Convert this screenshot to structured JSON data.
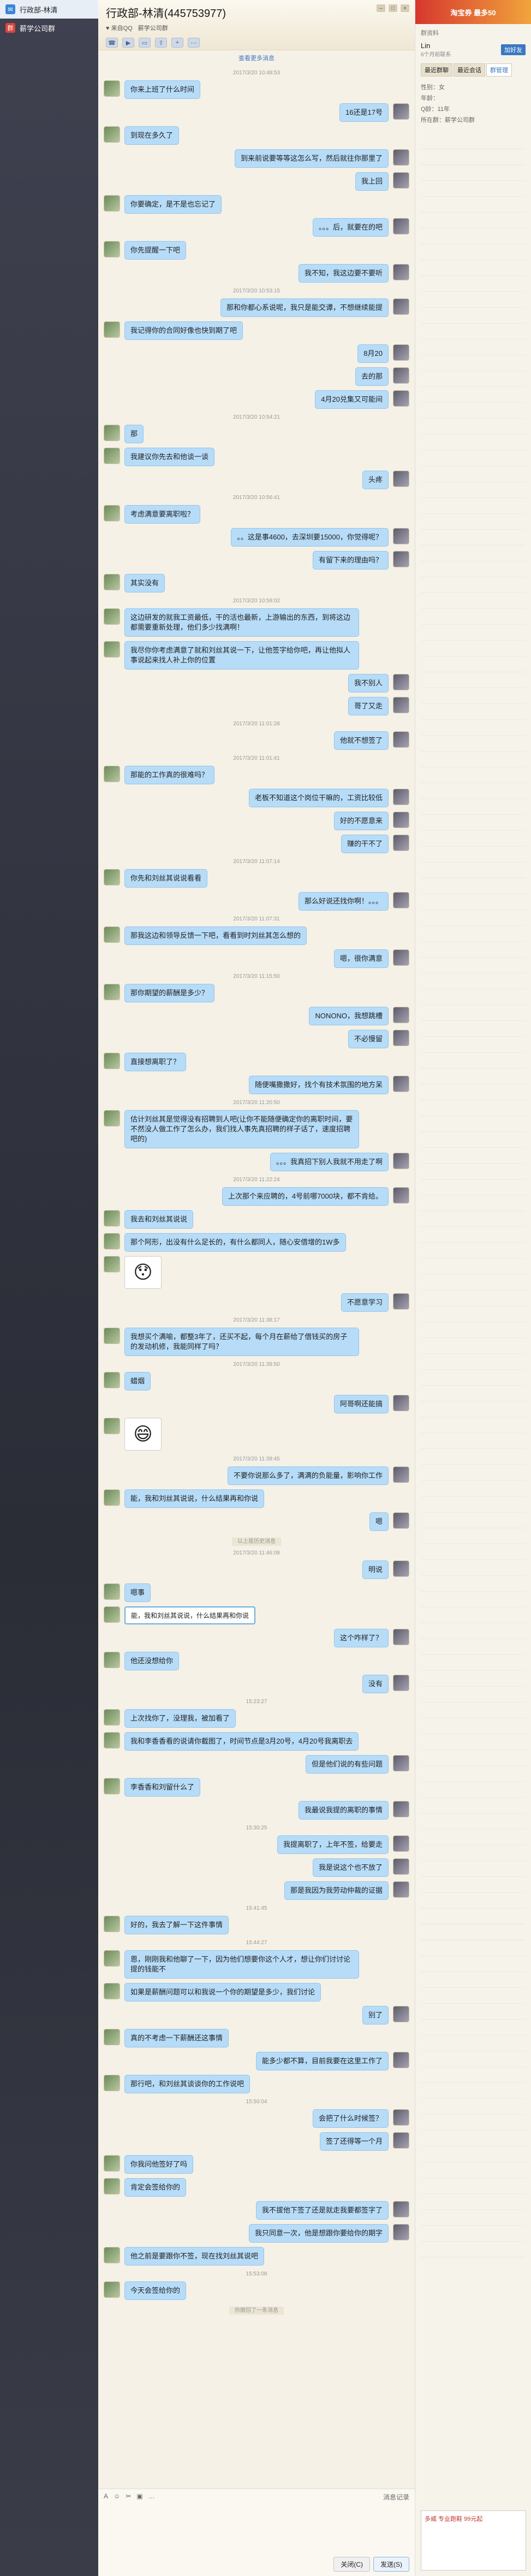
{
  "sessions": [
    {
      "label": "行政部-林清",
      "active": true
    },
    {
      "label": "薪学公司群",
      "active": false
    }
  ],
  "header": {
    "title": "行政部-林清(445753977)",
    "subtitle_left": "♥ 来自QQ",
    "subtitle_right": "薪学公司群"
  },
  "history_link": "查看更多消息",
  "messages": [
    {
      "type": "ts",
      "text": "2017/3/20 10:48:53"
    },
    {
      "type": "left",
      "text": "你来上班了什么时间"
    },
    {
      "type": "right",
      "text": "16还是17号"
    },
    {
      "type": "left",
      "text": "到现在多久了"
    },
    {
      "type": "right",
      "text": "到来前说要等等这怎么写，然后就往你那里了"
    },
    {
      "type": "right",
      "text": "我上回"
    },
    {
      "type": "left",
      "text": "你要确定，是不是也忘记了"
    },
    {
      "type": "right",
      "text": "。。。后，就要在的吧"
    },
    {
      "type": "left",
      "text": "你先提醒一下吧"
    },
    {
      "type": "right",
      "text": "我不知，我这边要不要听"
    },
    {
      "type": "ts",
      "text": "2017/3/20 10:53:15"
    },
    {
      "type": "right",
      "text": "那和你都心系说呢，我只是能交谭，不想继续能提"
    },
    {
      "type": "left",
      "text": "我记得你的合同好像也快到期了吧"
    },
    {
      "type": "right",
      "text": "8月20"
    },
    {
      "type": "right",
      "text": "去的那"
    },
    {
      "type": "right",
      "text": "4月20兑集又可能间"
    },
    {
      "type": "ts",
      "text": "2017/3/20 10:54:21"
    },
    {
      "type": "left",
      "text": "那"
    },
    {
      "type": "left",
      "text": "我建议你先去和他谈一谈"
    },
    {
      "type": "right",
      "text": "头疼"
    },
    {
      "type": "ts",
      "text": "2017/3/20 10:56:41"
    },
    {
      "type": "left",
      "text": "考虑满意要离职啦？"
    },
    {
      "type": "right",
      "text": "。。这是事4600，去深圳要15000，你觉得呢？"
    },
    {
      "type": "right",
      "text": "有留下来的理由吗？"
    },
    {
      "type": "left",
      "text": "其实没有"
    },
    {
      "type": "ts",
      "text": "2017/3/20 10:58:02"
    },
    {
      "type": "left",
      "text": "这边研发的就我工资最低，干的活也最新，上游输出的东西，到将这边都需要重新处理，他们多少找满啊！"
    },
    {
      "type": "left",
      "text": "我尽你你考虑满意了就和刘丝其说一下，让他签字给你吧，再让他拟人事说起来找人补上你的位置"
    },
    {
      "type": "right",
      "text": "我不别人"
    },
    {
      "type": "right",
      "text": "哥了又走"
    },
    {
      "type": "ts",
      "text": "2017/3/20 11:01:28"
    },
    {
      "type": "right",
      "text": "他就不想签了"
    },
    {
      "type": "ts",
      "text": "2017/3/20 11:01:41"
    },
    {
      "type": "left",
      "text": "那能的工作真的很难吗？"
    },
    {
      "type": "right",
      "text": "老板不知道这个岗位干嘛的，工资比较低"
    },
    {
      "type": "right",
      "text": "好的不愿意来"
    },
    {
      "type": "right",
      "text": "赚的干不了"
    },
    {
      "type": "ts",
      "text": "2017/3/20 11:07:14"
    },
    {
      "type": "left",
      "text": "你先和刘丝其说说看看"
    },
    {
      "type": "right",
      "text": "那么好说还找你啊！。。。"
    },
    {
      "type": "ts",
      "text": "2017/3/20 11:07:31"
    },
    {
      "type": "left",
      "text": "那我这边和领导反馈一下吧，看看到时刘丝其怎么想的"
    },
    {
      "type": "right",
      "text": "嗯，很你满意"
    },
    {
      "type": "ts",
      "text": "2017/3/20 11:15:50"
    },
    {
      "type": "left",
      "text": "那你期望的薪酬是多少？"
    },
    {
      "type": "right",
      "text": "NONONO，我想跳槽"
    },
    {
      "type": "right",
      "text": "不必慢留"
    },
    {
      "type": "left",
      "text": "直接想离职了？"
    },
    {
      "type": "right",
      "text": "随便嘴撒撒好，找个有技术氛围的地方呆"
    },
    {
      "type": "ts",
      "text": "2017/3/20 11:20:50"
    },
    {
      "type": "left",
      "text": "估计刘丝其是觉得没有招聘到人吧(让你不能随便确定你的离职时间，要不然没人做工作了怎么办，我们找人事先真招聘的样子话了，速度招聘吧的)"
    },
    {
      "type": "right",
      "text": "。。。我真招下别人我就不用走了啊"
    },
    {
      "type": "ts",
      "text": "2017/3/20 11:22:24"
    },
    {
      "type": "right",
      "text": "上次那个来应聘的，4号前哪7000块，都不肯给。"
    },
    {
      "type": "left",
      "text": "我去和刘丝其说说"
    },
    {
      "type": "left",
      "text": "那个阿形，出没有什么足长的，有什么都同人，随心安借增的1W多"
    },
    {
      "type": "left",
      "sticker": "😯"
    },
    {
      "type": "right",
      "text": "不愿意学习"
    },
    {
      "type": "ts",
      "text": "2017/3/20 11:38:17"
    },
    {
      "type": "left",
      "text": "我想买个满喻，都整3年了，还买不起，每个月在薪给了借钱买的房子的发动机修，我能同样了吗？"
    },
    {
      "type": "ts",
      "text": "2017/3/20 11:39:50"
    },
    {
      "type": "left",
      "text": "蜡烟"
    },
    {
      "type": "right",
      "text": "阿哥啊还能搞"
    },
    {
      "type": "left",
      "sticker": "😄"
    },
    {
      "type": "ts",
      "text": "2017/3/20 11:39:45"
    },
    {
      "type": "right",
      "text": "不要你说那么多了，满满的负能量，影响你工作"
    },
    {
      "type": "left",
      "text": "能，我和刘丝其说说，什么结果再和你说"
    },
    {
      "type": "right",
      "text": "嗯"
    },
    {
      "type": "sys",
      "text": "以上是历史消息"
    },
    {
      "type": "ts",
      "text": "2017/3/20 11:46:08"
    },
    {
      "type": "right",
      "text": "明说"
    },
    {
      "type": "left",
      "text": "嗯事"
    },
    {
      "type": "quote",
      "text": "能，我和刘丝其说说，什么结果再和你说"
    },
    {
      "type": "right",
      "text": "这个咋样了？"
    },
    {
      "type": "left",
      "text": "他还没想给你"
    },
    {
      "type": "right",
      "text": "没有"
    },
    {
      "type": "ts",
      "text": "15:23:27"
    },
    {
      "type": "left",
      "text": "上次找你了，没理我，被加看了"
    },
    {
      "type": "left",
      "text": "我和李香香看的说请你截图了，时间节点是3月20号，4月20号我离职去"
    },
    {
      "type": "right",
      "text": "但是他们说的有些问题"
    },
    {
      "type": "left",
      "text": "李香香和刘留什么了"
    },
    {
      "type": "right",
      "text": "我最说我提的离职的事情"
    },
    {
      "type": "ts",
      "text": "15:30:25"
    },
    {
      "type": "right",
      "text": "我提离职了，上年不签，给要走"
    },
    {
      "type": "right",
      "text": "我是说这个也不放了"
    },
    {
      "type": "right",
      "text": "那是我因为我劳动仲裁的证据"
    },
    {
      "type": "ts",
      "text": "15:41:45"
    },
    {
      "type": "left",
      "text": "好的，我去了解一下这件事情"
    },
    {
      "type": "ts",
      "text": "15:44:27"
    },
    {
      "type": "left",
      "text": "恩，刚刚我和他聊了一下，因为他们想要你这个人才，想让你们讨讨论提的钱能不"
    },
    {
      "type": "left",
      "text": "如果是薪酬问题可以和我说一个你的期望是多少，我们讨论"
    },
    {
      "type": "right",
      "text": "别了"
    },
    {
      "type": "left",
      "text": "真的不考虑一下薪酬还这事情"
    },
    {
      "type": "right",
      "text": "能多少都不算，目前我要在这里工作了"
    },
    {
      "type": "left",
      "text": "那行吧，和刘丝其谈谈你的工作说吧"
    },
    {
      "type": "ts",
      "text": "15:50:04"
    },
    {
      "type": "right",
      "text": "会把了什么时候签？"
    },
    {
      "type": "right",
      "text": "签了还得等一个月"
    },
    {
      "type": "left",
      "text": "你我问他签好了吗"
    },
    {
      "type": "left",
      "text": "肯定会签给你的"
    },
    {
      "type": "right",
      "text": "我不拔他下签了还是就走我要都签字了"
    },
    {
      "type": "right",
      "text": "我只同意一次，他是想跟你要给你的期字"
    },
    {
      "type": "left",
      "text": "他之前是要跟你不签，现在找刘丝其说吧"
    },
    {
      "type": "ts",
      "text": "15:53:08"
    },
    {
      "type": "left",
      "text": "今天会签给你的"
    },
    {
      "type": "hint",
      "text": "你撤回了一条消息"
    }
  ],
  "input": {
    "toolbar": [
      "A",
      "☺",
      "✂",
      "▣",
      "…"
    ],
    "history_btn": "消息记录",
    "close_btn": "关闭(C)",
    "send_btn": "发送(S)"
  },
  "right_panel": {
    "ad_text": "淘宝券 最多50",
    "title": "群资料",
    "user_name": "Lin",
    "user_sub": "6个月前联系",
    "add_friend": "加好友",
    "tabs": [
      "最近群聊",
      "最近会话",
      "群管理"
    ],
    "info": [
      "性别：女",
      "年龄：",
      "Q龄：11年",
      "所在群：薪学公司群"
    ],
    "shoe_ad": "多威 专业跑鞋 99元起"
  }
}
